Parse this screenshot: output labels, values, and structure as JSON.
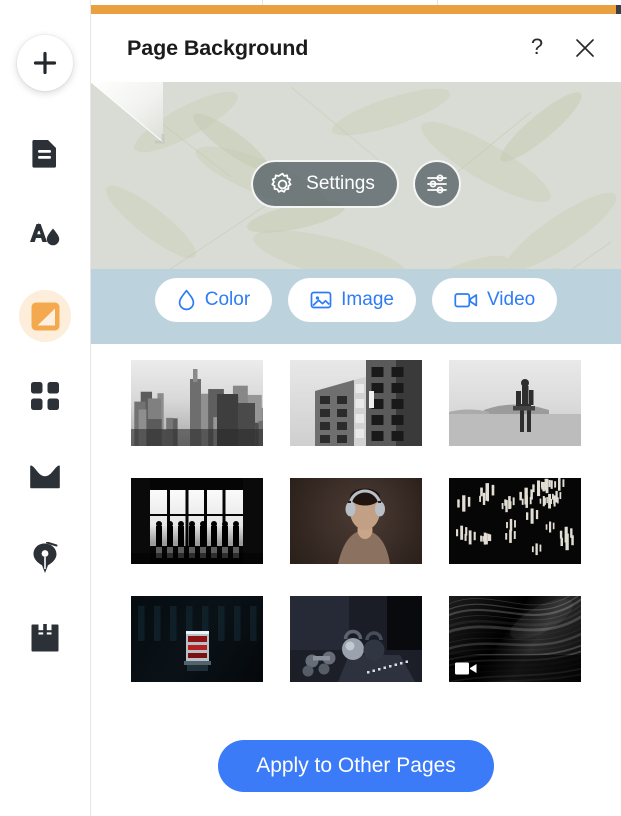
{
  "window": {
    "top_bar_color": "#e9a13f",
    "background": "#ffffff"
  },
  "sidebar": {
    "items": [
      {
        "name": "add",
        "icon": "plus-icon",
        "label": "",
        "selected": false
      },
      {
        "name": "pages",
        "icon": "document-icon",
        "label": "",
        "selected": false
      },
      {
        "name": "text-color",
        "icon": "text-color-droplet-icon",
        "label": "",
        "selected": false
      },
      {
        "name": "background",
        "icon": "page-background-icon",
        "label": "",
        "selected": true
      },
      {
        "name": "elements",
        "icon": "grid-squares-icon",
        "label": "",
        "selected": false
      },
      {
        "name": "mail",
        "icon": "envelope-icon",
        "label": "",
        "selected": false
      },
      {
        "name": "draw",
        "icon": "pen-nib-icon",
        "label": "",
        "selected": false
      },
      {
        "name": "save",
        "icon": "save-floppy-icon",
        "label": "",
        "selected": false
      }
    ],
    "selected_accent": "#f5a94e",
    "selected_bg": "#fdeedb"
  },
  "dialog": {
    "title": "Page Background",
    "help_label": "?",
    "close_label": "×"
  },
  "hero": {
    "settings_label": "Settings",
    "settings_icon": "gear-icon",
    "adjust_icon": "sliders-icon",
    "pill_color": "#556065",
    "band_color": "#bcd3dd",
    "base_color": "#d8dbd3",
    "tabs": [
      {
        "label": "Color",
        "icon": "droplet-icon",
        "accent": "#2d7cf6"
      },
      {
        "label": "Image",
        "icon": "picture-icon",
        "accent": "#2d7cf6"
      },
      {
        "label": "Video",
        "icon": "video-camera-icon",
        "accent": "#2d7cf6"
      }
    ]
  },
  "thumbnails": {
    "rows": [
      [
        {
          "name": "city-skyline",
          "style": "skyline",
          "badge": null
        },
        {
          "name": "architecture-building",
          "style": "building",
          "badge": null
        },
        {
          "name": "desert-figure",
          "style": "desert",
          "badge": null
        }
      ],
      [
        {
          "name": "window-silhouettes",
          "style": "window",
          "badge": null
        },
        {
          "name": "man-with-headphones",
          "style": "portrait",
          "badge": null
        },
        {
          "name": "cactus-pattern",
          "style": "cactus",
          "badge": null
        }
      ],
      [
        {
          "name": "dark-drink-glass",
          "style": "drink",
          "badge": null
        },
        {
          "name": "gym-equipment",
          "style": "gym",
          "badge": null
        },
        {
          "name": "dark-abstract-video",
          "style": "abstract",
          "badge": "video-badge-icon"
        }
      ]
    ]
  },
  "footer": {
    "apply_label": "Apply to Other Pages",
    "apply_color": "#3b7bf7"
  }
}
